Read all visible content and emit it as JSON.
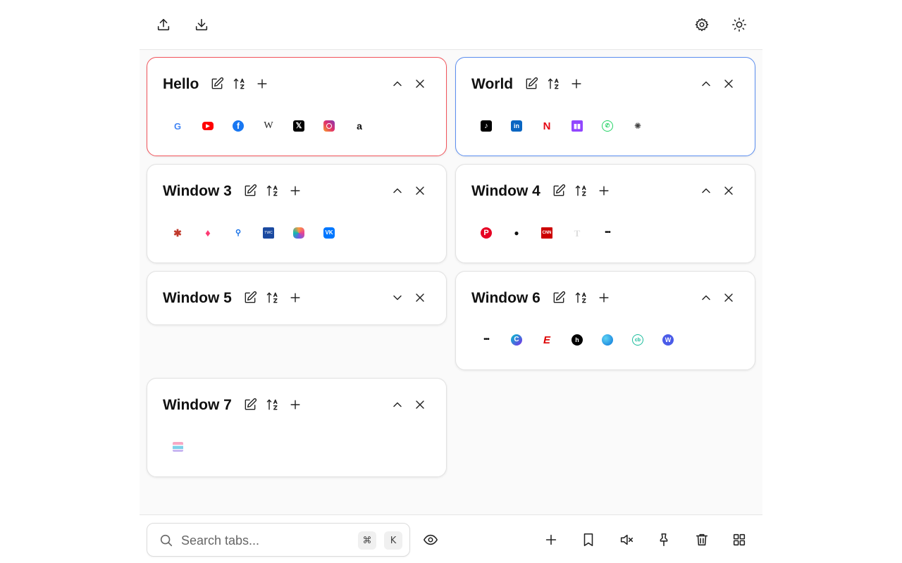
{
  "topbar": {
    "icons": [
      "upload-icon",
      "download-icon",
      "gear-icon",
      "sun-icon"
    ]
  },
  "windows": [
    {
      "title": "Hello",
      "highlight": "#f2545b",
      "collapsed": false,
      "tabs": [
        "google",
        "youtube",
        "facebook",
        "wikipedia",
        "x",
        "instagram",
        "amazon"
      ]
    },
    {
      "title": "World",
      "highlight": "#5b8ef0",
      "collapsed": false,
      "tabs": [
        "tiktok",
        "linkedin",
        "netflix",
        "twitch",
        "whatsapp",
        "openai"
      ]
    },
    {
      "title": "Window 3",
      "collapsed": false,
      "tabs": [
        "spider",
        "tinder",
        "search",
        "weather-channel",
        "copilot",
        "vk"
      ]
    },
    {
      "title": "Window 4",
      "collapsed": false,
      "tabs": [
        "pinterest",
        "apple",
        "cnn",
        "nytimes",
        "dots"
      ]
    },
    {
      "title": "Window 5",
      "collapsed": true,
      "tabs": []
    },
    {
      "title": "Window 6",
      "collapsed": false,
      "tabs": [
        "dots",
        "canva",
        "espn",
        "notion",
        "edge",
        "coinbase",
        "word"
      ]
    },
    {
      "title": "Window 7",
      "collapsed": false,
      "tabs": [
        "stack"
      ]
    }
  ],
  "search": {
    "placeholder": "Search tabs...",
    "shortcut_mod": "⌘",
    "shortcut_key": "K"
  },
  "colors": {
    "active_red": "#f2545b",
    "active_blue": "#5b8ef0"
  }
}
